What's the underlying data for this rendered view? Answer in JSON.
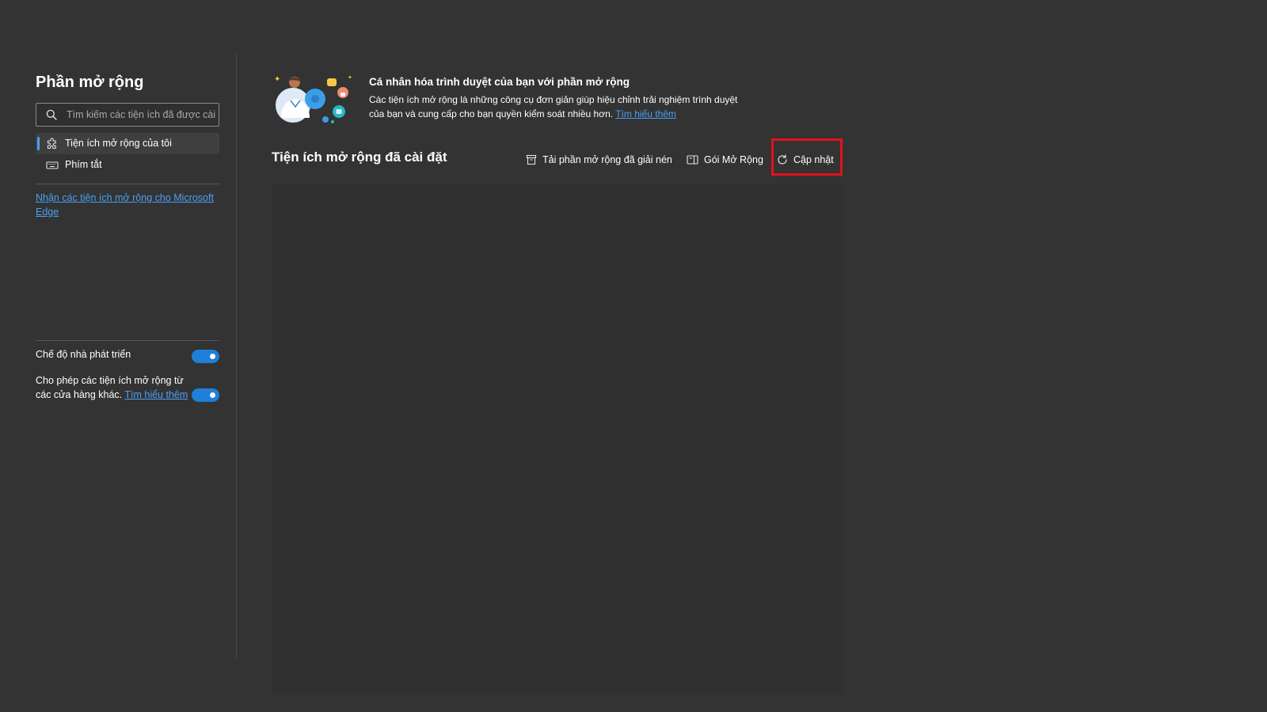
{
  "sidebar": {
    "title": "Phần mở rộng",
    "search_placeholder": "Tìm kiếm các tiện ích đã được cài",
    "nav": [
      {
        "label": "Tiện ích mở rộng của tôi",
        "icon": "extension-icon",
        "active": true
      },
      {
        "label": "Phím tắt",
        "icon": "keyboard-icon",
        "active": false
      }
    ],
    "store_link": "Nhận các tiện ích mở rộng cho Microsoft Edge",
    "developer_mode": {
      "label": "Chế độ nhà phát triển",
      "enabled": true
    },
    "allow_other_stores": {
      "text": "Cho phép các tiện ích mở rộng từ các cửa hàng khác.",
      "link": "Tìm hiểu thêm",
      "enabled": true
    }
  },
  "promo": {
    "title": "Cá nhân hóa trình duyệt của bạn với phần mở rộng",
    "description": "Các tiện ích mở rộng là những công cụ đơn giản giúp hiệu chỉnh trải nghiệm trình duyệt của bạn và cung cấp cho bạn quyền kiểm soát nhiều hơn.",
    "link": "Tìm hiểu thêm"
  },
  "installed": {
    "title": "Tiện ích mở rộng đã cài đặt",
    "actions": [
      {
        "label": "Tải phần mở rộng đã giải nén",
        "icon": "load-unpacked-icon"
      },
      {
        "label": "Gói Mở Rộng",
        "icon": "pack-extension-icon"
      },
      {
        "label": "Cập nhật",
        "icon": "refresh-icon"
      }
    ]
  },
  "colors": {
    "background": "#333333",
    "accent": "#4aa0f2",
    "toggle_on": "#1f7fd9",
    "highlight": "#e3121b"
  }
}
